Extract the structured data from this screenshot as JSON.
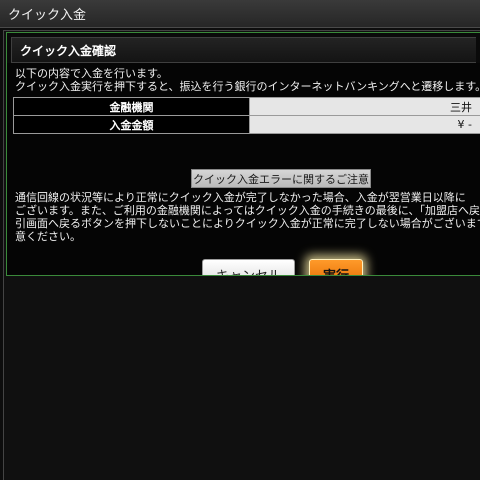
{
  "window": {
    "title": "クイック入金"
  },
  "dialog": {
    "title": "クイック入金確認",
    "intro_line1": "以下の内容で入金を行います。",
    "intro_line2": "クイック入金実行を押下すると、振込を行う銀行のインターネットバンキングへと遷移します。",
    "table": {
      "rows": [
        {
          "label": "金融機関",
          "value": "三井"
        },
        {
          "label": "入金金額",
          "value": "¥ -"
        }
      ]
    },
    "notice_button_label": "クイック入金エラーに関するご注意",
    "warning_lines": [
      "通信回線の状況等により正常にクイック入金が完了しなかった場合、入金が翌営業日以降に",
      "ございます。また、ご利用の金融機関によってはクイック入金の手続きの最後に、「加盟店へ戻",
      "引画面へ戻るボタンを押下しないことによりクイック入金が正常に完了しない場合がございます",
      "意ください。"
    ],
    "cancel_label": "キャンセル",
    "execute_label": "実行"
  },
  "colors": {
    "dialog_border": "#3a8a3a",
    "execute_button": "#f07d0a",
    "table_value_bg": "#e6e6e6"
  }
}
